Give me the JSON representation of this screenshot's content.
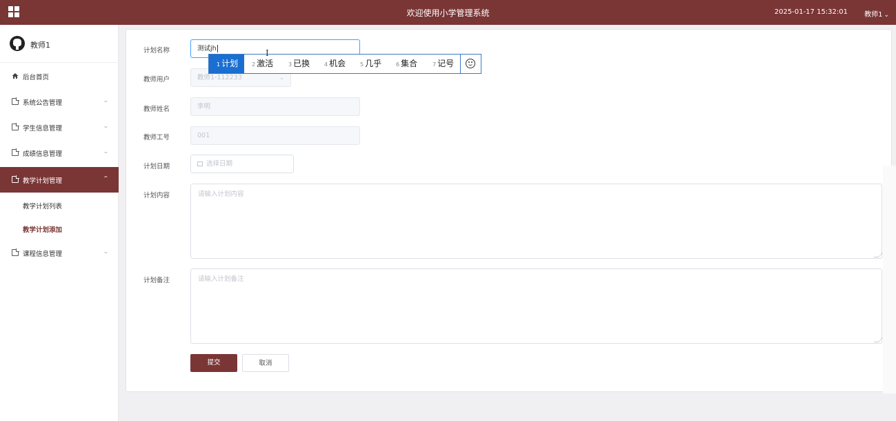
{
  "header": {
    "title": "欢迎使用小学管理系统",
    "datetime": "2025-01-17 15:32:01",
    "user": "教师1"
  },
  "sidebar": {
    "profile_name": "教师1",
    "items": [
      {
        "label": "后台首页",
        "icon": "home-icon"
      },
      {
        "label": "系统公告管理",
        "icon": "doc-icon",
        "expandable": true
      },
      {
        "label": "学生信息管理",
        "icon": "doc-icon",
        "expandable": true
      },
      {
        "label": "成绩信息管理",
        "icon": "doc-icon",
        "expandable": true
      },
      {
        "label": "教学计划管理",
        "icon": "doc-icon",
        "expandable": true,
        "active": true
      },
      {
        "label": "课程信息管理",
        "icon": "doc-icon",
        "expandable": true
      }
    ],
    "subitems": [
      {
        "label": "教学计划列表"
      },
      {
        "label": "教学计划添加",
        "current": true
      }
    ]
  },
  "form": {
    "plan_name": {
      "label": "计划名称",
      "value": "测试jh"
    },
    "teacher_user": {
      "label": "教师用户",
      "value": "教师1-112233"
    },
    "teacher_name": {
      "label": "教师姓名",
      "value": "李明"
    },
    "teacher_no": {
      "label": "教师工号",
      "value": "001"
    },
    "plan_date": {
      "label": "计划日期",
      "placeholder": "选择日期"
    },
    "plan_content": {
      "label": "计划内容",
      "placeholder": "请输入计划内容"
    },
    "plan_note": {
      "label": "计划备注",
      "placeholder": "请输入计划备注"
    },
    "submit": "提交",
    "cancel": "取消"
  },
  "ime": {
    "candidates": [
      {
        "num": "1",
        "text": "计划"
      },
      {
        "num": "2",
        "text": "激活"
      },
      {
        "num": "3",
        "text": "已换"
      },
      {
        "num": "4",
        "text": "机会"
      },
      {
        "num": "5",
        "text": "几乎"
      },
      {
        "num": "6",
        "text": "集合"
      },
      {
        "num": "7",
        "text": "记号"
      }
    ],
    "emoji_icon": "smiley-icon"
  },
  "colors": {
    "brand": "#7a3535",
    "ime_selected": "#1a6fd1",
    "focus": "#409eff"
  }
}
